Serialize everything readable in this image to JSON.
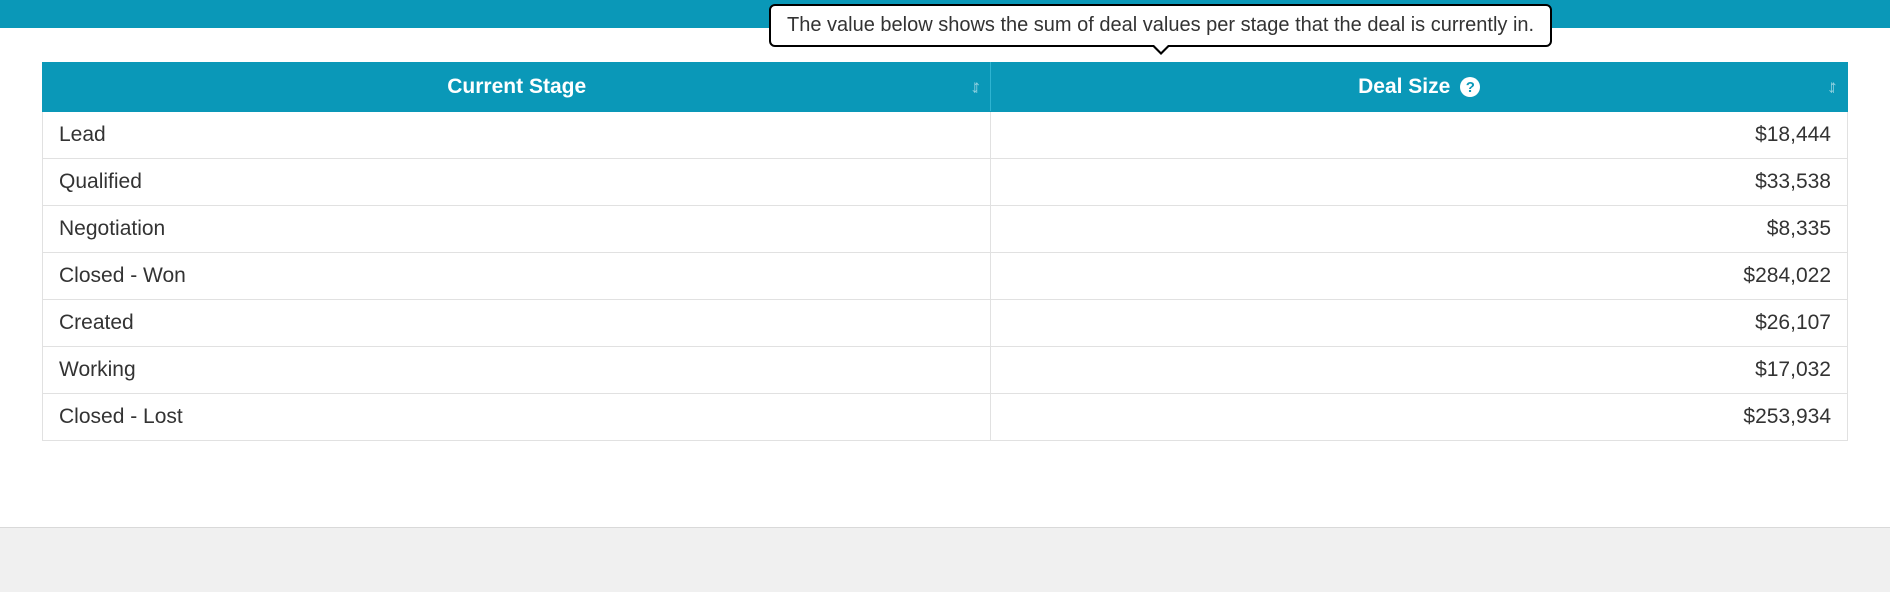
{
  "tooltip": {
    "text": "The value below shows the sum of deal values per stage that the deal is currently in."
  },
  "table": {
    "columns": {
      "stage": "Current Stage",
      "size": "Deal Size"
    },
    "rows": [
      {
        "stage": "Lead",
        "size": "$18,444"
      },
      {
        "stage": "Qualified",
        "size": "$33,538"
      },
      {
        "stage": "Negotiation",
        "size": "$8,335"
      },
      {
        "stage": "Closed - Won",
        "size": "$284,022"
      },
      {
        "stage": "Created",
        "size": "$26,107"
      },
      {
        "stage": "Working",
        "size": "$17,032"
      },
      {
        "stage": "Closed - Lost",
        "size": "$253,934"
      }
    ]
  }
}
